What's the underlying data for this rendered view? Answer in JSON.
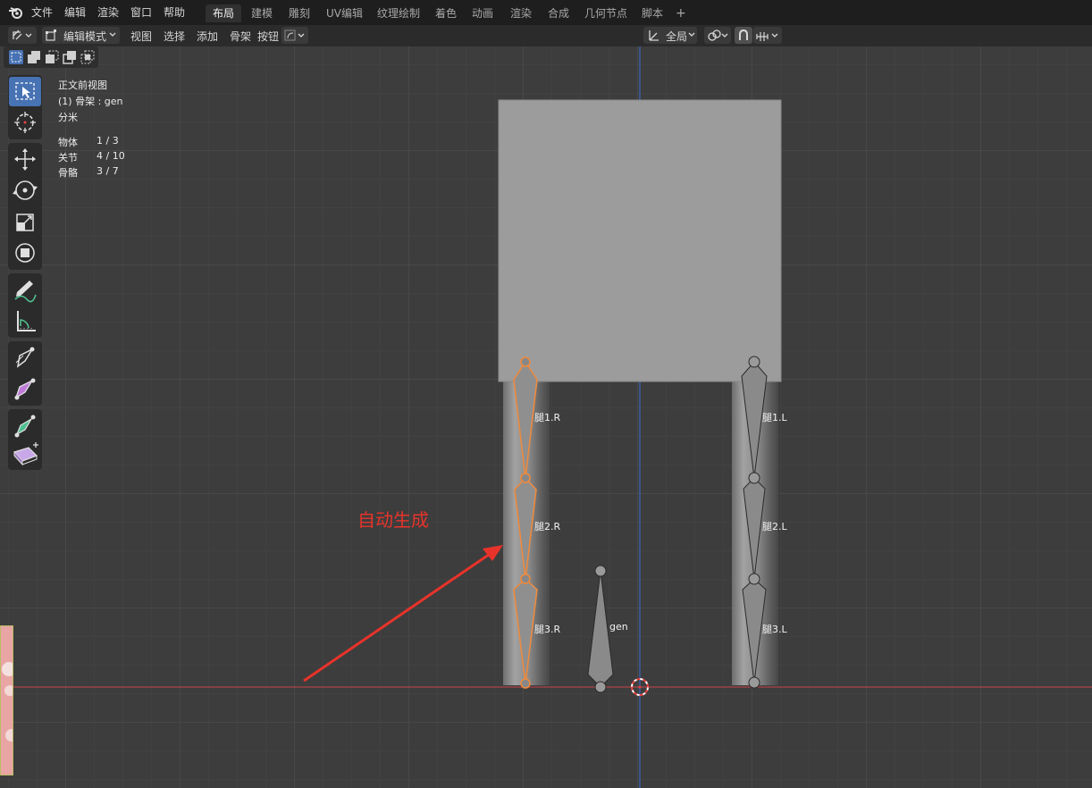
{
  "menu": {
    "items": [
      "文件",
      "编辑",
      "渲染",
      "窗口",
      "帮助"
    ]
  },
  "workspaces": {
    "tabs": [
      "布局",
      "建模",
      "雕刻",
      "UV编辑",
      "纹理绘制",
      "着色",
      "动画",
      "渲染",
      "合成",
      "几何节点",
      "脚本"
    ],
    "add": "+"
  },
  "header": {
    "mode": "编辑模式",
    "view": "视图",
    "select": "选择",
    "add": "添加",
    "armature": "骨架",
    "button": "按钮",
    "orientation": "全局"
  },
  "overlay_info": {
    "view_name": "正文前视图",
    "object_line": "(1) 骨架 : gen",
    "units": "分米",
    "stats": [
      {
        "label": "物体",
        "value": "1 / 3"
      },
      {
        "label": "关节",
        "value": "4 / 10"
      },
      {
        "label": "骨骼",
        "value": "3 / 7"
      }
    ]
  },
  "annotation": "自动生成",
  "bones": {
    "right": [
      "腿1.R",
      "腿2.R",
      "腿3.R"
    ],
    "left": [
      "腿1.L",
      "腿2.L",
      "腿3.L"
    ],
    "root": "gen"
  },
  "colors": {
    "accent": "#4772b3",
    "x_axis": "#c8434a",
    "z_axis": "#3b6fd6",
    "selected_bone": "#f08a3c",
    "annotation": "#e8332a"
  },
  "tools": [
    "select-box-icon",
    "cursor-icon",
    "move-icon",
    "rotate-icon",
    "scale-icon",
    "transform-icon",
    "annotate-icon",
    "measure-icon",
    "bone-size-icon",
    "bone-envelope-icon",
    "extrude-icon",
    "roll-icon"
  ]
}
